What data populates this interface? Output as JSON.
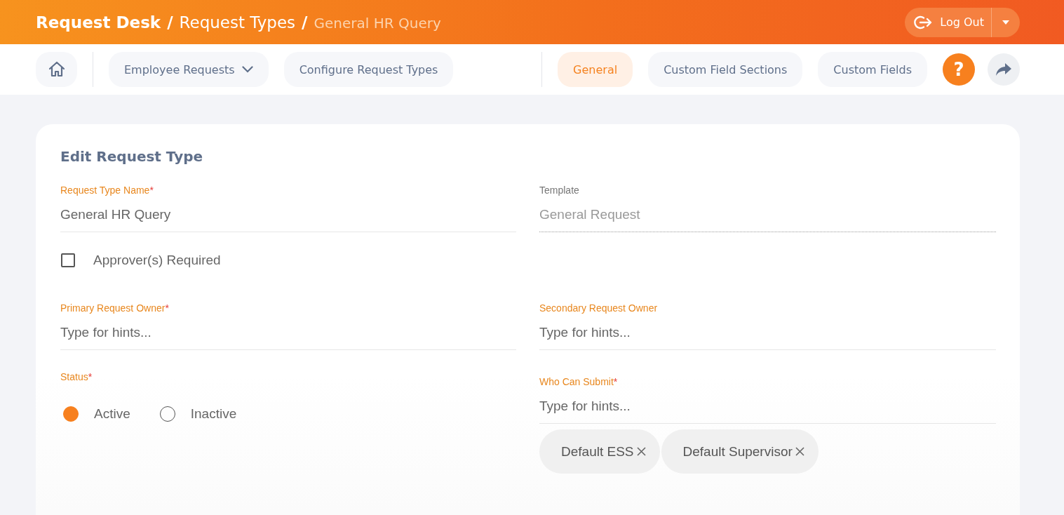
{
  "header": {
    "breadcrumb": [
      {
        "label": "Request Desk",
        "separator": "/",
        "current": false
      },
      {
        "label": "Request Types",
        "separator": "/",
        "current": false
      },
      {
        "label": "General HR Query",
        "current": true
      }
    ],
    "logout": {
      "label": "Log Out"
    }
  },
  "nav": {
    "menus": [
      {
        "label": "Employee Requests",
        "dropdown": true
      },
      {
        "label": "Configure Request Types",
        "dropdown": false
      }
    ],
    "tabs": [
      {
        "label": "General",
        "selected": true
      },
      {
        "label": "Custom Field Sections",
        "selected": false
      },
      {
        "label": "Custom Fields",
        "selected": false
      }
    ],
    "help": "?"
  },
  "form": {
    "title": "Edit Request Type",
    "request_type_name": {
      "label": "Request Type Name",
      "required_mark": "*",
      "value": "General HR Query",
      "disabled": false
    },
    "template": {
      "label": "Template",
      "value": "General Request",
      "disabled": true
    },
    "approvers_required": {
      "label": "Approver(s) Required",
      "checked": false
    },
    "primary_owner": {
      "label": "Primary Request Owner",
      "required_mark": "*",
      "placeholder": "Type for hints...",
      "disabled": false
    },
    "secondary_owner": {
      "label": "Secondary Request Owner",
      "placeholder": "Type for hints...",
      "disabled": false
    },
    "status": {
      "label": "Status",
      "required_mark": "*",
      "options": [
        {
          "label": "Active",
          "selected": true
        },
        {
          "label": "Inactive",
          "selected": false
        }
      ]
    },
    "who_can_submit": {
      "label": "Who Can Submit",
      "required_mark": "*",
      "placeholder": "Type for hints...",
      "disabled": false,
      "chips": [
        {
          "label": "Default ESS"
        },
        {
          "label": "Default Supervisor"
        }
      ]
    }
  }
}
